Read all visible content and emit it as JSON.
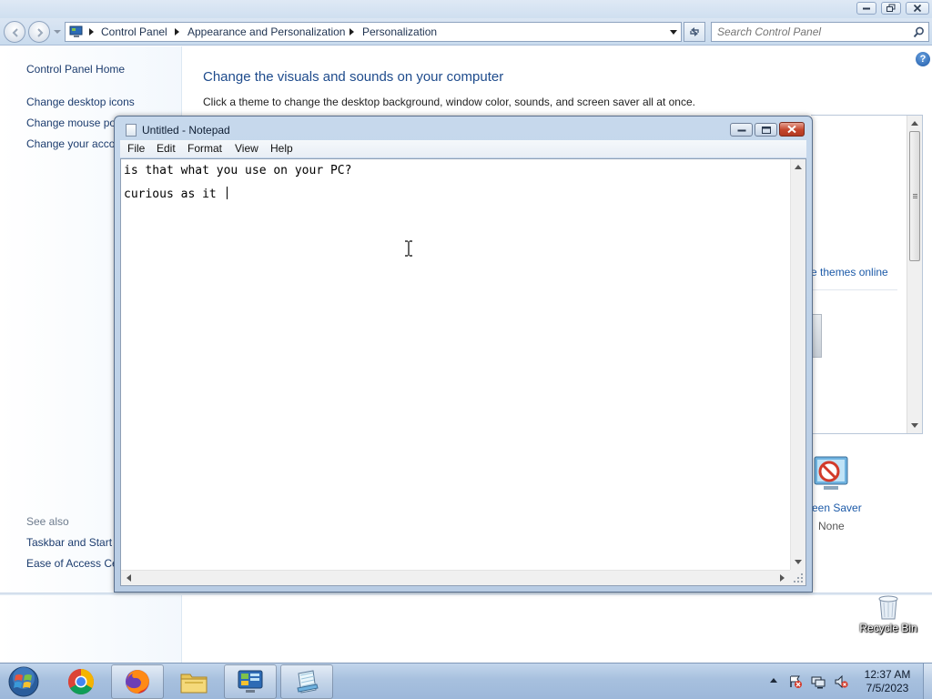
{
  "control_panel": {
    "breadcrumb": [
      "Control Panel",
      "Appearance and Personalization",
      "Personalization"
    ],
    "search_placeholder": "Search Control Panel",
    "left_nav": {
      "home": "Control Panel Home",
      "links": [
        "Change desktop icons",
        "Change mouse po",
        "Change your acco"
      ],
      "see_also_heading": "See also",
      "see_also_links": [
        "Taskbar and Start I",
        "Ease of Access Cer"
      ]
    },
    "main": {
      "title": "Change the visuals and sounds on your computer",
      "subtitle": "Click a theme to change the desktop background, window color, sounds, and screen saver all at once.",
      "get_themes_link": "e themes online",
      "screen_saver_label": "reen Saver",
      "screen_saver_value": "None"
    }
  },
  "notepad": {
    "title": "Untitled - Notepad",
    "menu": [
      "File",
      "Edit",
      "Format",
      "View",
      "Help"
    ],
    "text": "is that what you use on your PC?\ncurious as it "
  },
  "desktop": {
    "recycle_bin_label": "Recycle Bin"
  },
  "taskbar": {
    "apps": [
      "start-orb",
      "chrome-icon",
      "firefox-icon",
      "file-explorer-icon",
      "control-panel-icon",
      "notepad-icon"
    ],
    "clock_time": "12:37 AM",
    "clock_date": "7/5/2023"
  },
  "colors": {
    "link_blue": "#1c5aa8",
    "title_blue": "#1e4b8c",
    "taskbar": "#a7c0de",
    "close_red": "#c4452c"
  }
}
